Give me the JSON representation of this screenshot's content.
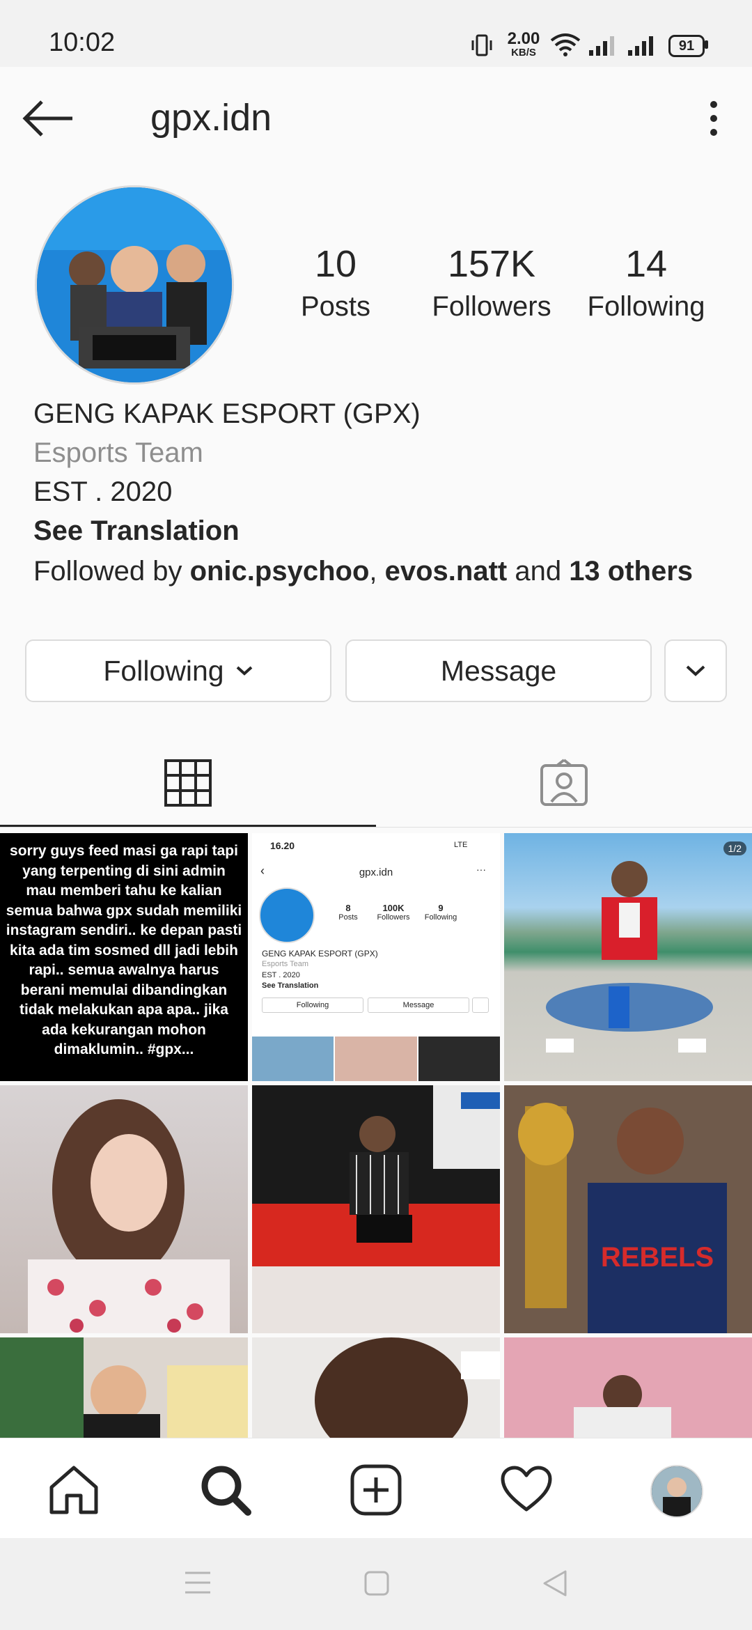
{
  "status_bar": {
    "time": "10:02",
    "network_speed_value": "2.00",
    "network_speed_unit": "KB/S",
    "battery": "91"
  },
  "header": {
    "username": "gpx.idn"
  },
  "profile": {
    "stats": [
      {
        "value": "10",
        "label": "Posts"
      },
      {
        "value": "157K",
        "label": "Followers"
      },
      {
        "value": "14",
        "label": "Following"
      }
    ],
    "name": "GENG KAPAK ESPORT (GPX)",
    "category": "Esports Team",
    "bio_line": "EST . 2020",
    "see_translation": "See Translation",
    "followed_by_prefix": "Followed by ",
    "followed_by_user1": "onic.psychoo",
    "followed_by_sep": ", ",
    "followed_by_user2": "evos.natt",
    "followed_by_and": " and ",
    "followed_by_others": "13 others"
  },
  "actions": {
    "following_label": "Following",
    "message_label": "Message"
  },
  "posts": {
    "text_post": "sorry guys feed masi ga rapi tapi yang terpenting di sini admin mau memberi tahu ke kalian semua bahwa gpx sudah memiliki instagram sendiri.. ke depan pasti kita ada tim sosmed dll jadi lebih rapi.. semua awalnya harus berani memulai dibandingkan tidak melakukan apa apa.. jika ada kekurangan mohon dimaklumin.. #gpx...",
    "screenshot_post": {
      "time": "16.20",
      "signal": "LTE",
      "username": "gpx.idn",
      "stats": [
        {
          "value": "8",
          "label": "Posts"
        },
        {
          "value": "100K",
          "label": "Followers"
        },
        {
          "value": "9",
          "label": "Following"
        }
      ],
      "name": "GENG KAPAK ESPORT (GPX)",
      "category": "Esports Team",
      "bio_line": "EST . 2020",
      "see_translation": "See Translation",
      "following_label": "Following",
      "message_label": "Message"
    },
    "carousel_badge": "1/2",
    "jersey_text": "REBELS"
  },
  "colors": {
    "text_primary": "#262626",
    "text_secondary": "#8e8e8e",
    "border": "#dbdbdb"
  }
}
